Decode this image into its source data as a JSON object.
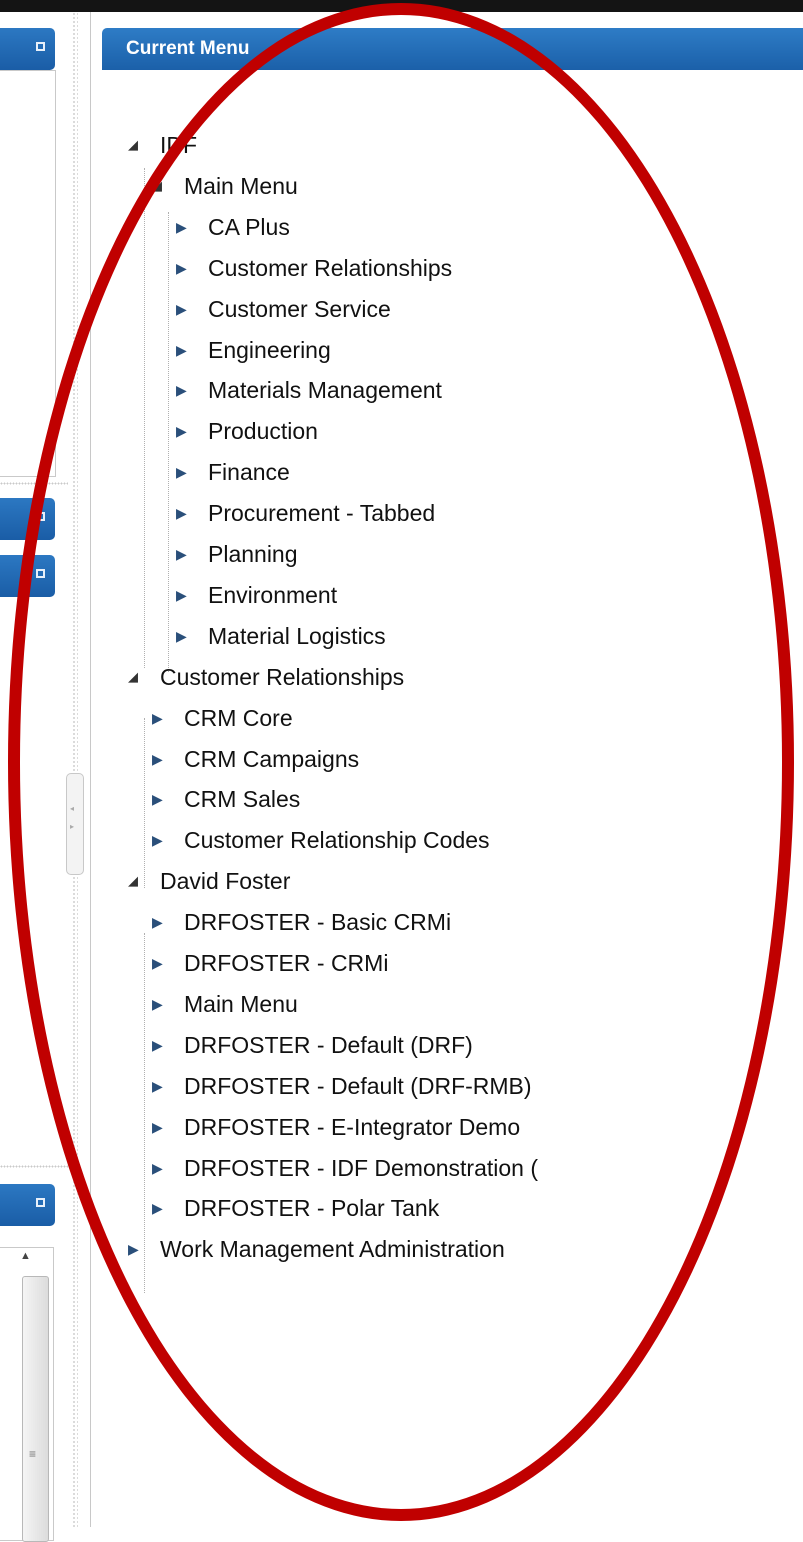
{
  "panel": {
    "title": "Current Menu"
  },
  "tree": [
    {
      "label": "IDF",
      "level": 0,
      "expanded": true,
      "id": "idf"
    },
    {
      "label": "Main Menu",
      "level": 1,
      "expanded": true,
      "id": "idf-main-menu"
    },
    {
      "label": "CA Plus",
      "level": 2,
      "expanded": false,
      "id": "ca-plus"
    },
    {
      "label": "Customer Relationships",
      "level": 2,
      "expanded": false,
      "id": "customer-relationships"
    },
    {
      "label": "Customer Service",
      "level": 2,
      "expanded": false,
      "id": "customer-service"
    },
    {
      "label": "Engineering",
      "level": 2,
      "expanded": false,
      "id": "engineering"
    },
    {
      "label": "Materials Management",
      "level": 2,
      "expanded": false,
      "id": "materials-management"
    },
    {
      "label": "Production",
      "level": 2,
      "expanded": false,
      "id": "production"
    },
    {
      "label": "Finance",
      "level": 2,
      "expanded": false,
      "id": "finance"
    },
    {
      "label": "Procurement - Tabbed",
      "level": 2,
      "expanded": false,
      "id": "procurement-tabbed"
    },
    {
      "label": "Planning",
      "level": 2,
      "expanded": false,
      "id": "planning"
    },
    {
      "label": "Environment",
      "level": 2,
      "expanded": false,
      "id": "environment"
    },
    {
      "label": "Material Logistics",
      "level": 2,
      "expanded": false,
      "id": "material-logistics"
    },
    {
      "label": "Customer Relationships",
      "level": 0,
      "expanded": true,
      "id": "customer-relationships-root"
    },
    {
      "label": "CRM Core",
      "level": 1,
      "expanded": false,
      "id": "crm-core"
    },
    {
      "label": "CRM Campaigns",
      "level": 1,
      "expanded": false,
      "id": "crm-campaigns"
    },
    {
      "label": "CRM Sales",
      "level": 1,
      "expanded": false,
      "id": "crm-sales"
    },
    {
      "label": "Customer Relationship Codes",
      "level": 1,
      "expanded": false,
      "id": "customer-relationship-codes"
    },
    {
      "label": "David Foster",
      "level": 0,
      "expanded": true,
      "id": "david-foster"
    },
    {
      "label": "DRFOSTER - Basic CRMi",
      "level": 1,
      "expanded": false,
      "id": "drfoster-basic-crmi"
    },
    {
      "label": "DRFOSTER - CRMi",
      "level": 1,
      "expanded": false,
      "id": "drfoster-crmi"
    },
    {
      "label": "Main Menu",
      "level": 1,
      "expanded": false,
      "id": "df-main-menu"
    },
    {
      "label": "DRFOSTER - Default (DRF)",
      "level": 1,
      "expanded": false,
      "id": "drfoster-default-drf"
    },
    {
      "label": "DRFOSTER - Default (DRF-RMB)",
      "level": 1,
      "expanded": false,
      "id": "drfoster-default-drf-rmb"
    },
    {
      "label": "DRFOSTER - E-Integrator Demo",
      "level": 1,
      "expanded": false,
      "id": "drfoster-e-integrator-demo"
    },
    {
      "label": "DRFOSTER - IDF Demonstration (",
      "level": 1,
      "expanded": false,
      "id": "drfoster-idf-demonstration"
    },
    {
      "label": "DRFOSTER - Polar Tank",
      "level": 1,
      "expanded": false,
      "id": "drfoster-polar-tank"
    },
    {
      "label": "Work Management Administration",
      "level": 0,
      "expanded": false,
      "id": "work-management-administration"
    }
  ],
  "icons": {
    "expanded": "triangle-down-icon",
    "collapsed": "triangle-right-icon",
    "maximize": "maximize-icon"
  },
  "annotation": {
    "color": "#c00000"
  },
  "theme": {
    "header": "#1f65ae"
  }
}
